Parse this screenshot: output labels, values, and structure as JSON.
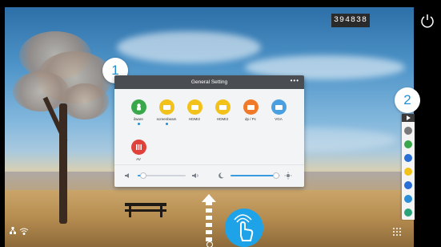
{
  "screen": {
    "code": "394838"
  },
  "callouts": {
    "one": "1",
    "two": "2"
  },
  "general_setting": {
    "title": "General Setting",
    "more": "•••",
    "sources": [
      {
        "label": "ilware",
        "icon": "android-icon",
        "color": "#3aa84a",
        "selected": true
      },
      {
        "label": "screenbeam",
        "icon": "hdmi-icon",
        "color": "#f2c21b",
        "selected": true
      },
      {
        "label": "HDMI2",
        "icon": "hdmi-icon",
        "color": "#f2c21b",
        "selected": false
      },
      {
        "label": "HDMI3",
        "icon": "hdmi-icon",
        "color": "#f2c21b",
        "selected": false
      },
      {
        "label": "dp / Pc",
        "icon": "displayport-icon",
        "color": "#f07a2a",
        "selected": false
      },
      {
        "label": "VGA",
        "icon": "vga-icon",
        "color": "#4a9fe0",
        "selected": false
      },
      {
        "label": "AV",
        "icon": "av-icon",
        "color": "#e0413a",
        "selected": false
      }
    ],
    "volume_level": 0.12,
    "brightness_level": 0.92
  },
  "toolbar": {
    "buttons": [
      {
        "icon": "back-icon",
        "color": "#7a7a7a"
      },
      {
        "icon": "home-icon",
        "color": "#3aa84a"
      },
      {
        "icon": "window-icon",
        "color": "#2a6fd6"
      },
      {
        "icon": "annotate-icon",
        "color": "#f2c21b"
      },
      {
        "icon": "settings-icon",
        "color": "#2a6fd6"
      },
      {
        "icon": "apps-icon",
        "color": "#2a8fd6"
      },
      {
        "icon": "record-icon",
        "color": "#2aa37a"
      }
    ]
  },
  "colors": {
    "accent": "#1e8fd6",
    "slider_fill": "#3b9be0",
    "panel_header": "#4a4d52"
  }
}
